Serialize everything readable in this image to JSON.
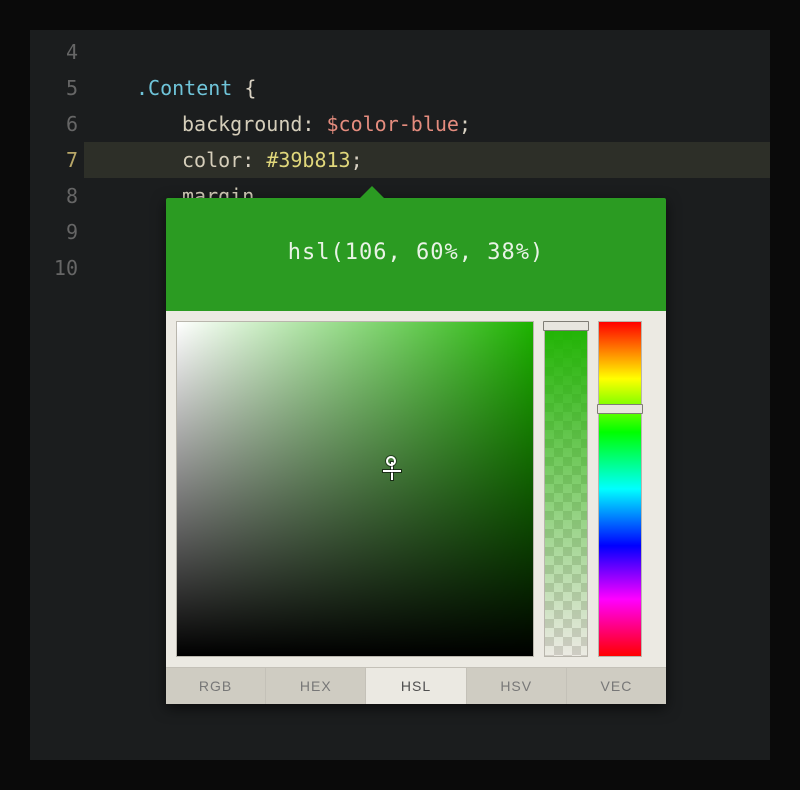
{
  "editor": {
    "active_line": "7",
    "line_numbers": [
      "4",
      "5",
      "6",
      "7",
      "8",
      "9",
      "10"
    ],
    "tokens": {
      "selector": ".Content",
      "brace_open": " {",
      "prop_background": "background",
      "colon_space": ": ",
      "var_color_blue": "$color-blue",
      "semicolon": ";",
      "prop_color": "color",
      "hex_value": "#39b813",
      "prop_margin_frag": "margin"
    }
  },
  "picker": {
    "header_text": "hsl(106, 60%, 38%)",
    "base_color": "#2b9b22",
    "hue_color": "#1db300",
    "active_tab": "HSL",
    "tabs": [
      "RGB",
      "HEX",
      "HSL",
      "HSV",
      "VEC"
    ]
  }
}
